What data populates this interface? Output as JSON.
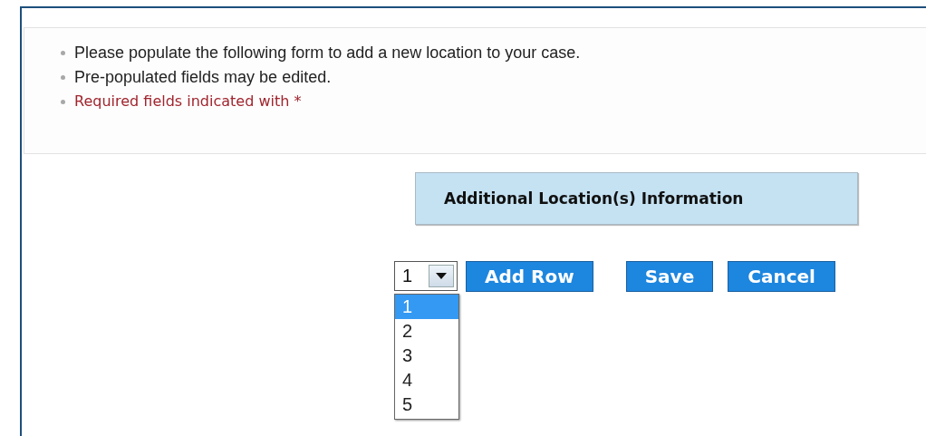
{
  "notes": [
    {
      "text": "Please populate the following form to add a new location to your case.",
      "kind": "normal"
    },
    {
      "text": "Pre-populated fields may be edited.",
      "kind": "normal"
    },
    {
      "text": "Required fields indicated with *",
      "kind": "required"
    }
  ],
  "section_title": "Additional Location(s) Information",
  "row_count_select": {
    "value": "1",
    "expanded": true,
    "options": [
      {
        "label": "1",
        "selected": true
      },
      {
        "label": "2",
        "selected": false
      },
      {
        "label": "3",
        "selected": false
      },
      {
        "label": "4",
        "selected": false
      },
      {
        "label": "5",
        "selected": false
      }
    ]
  },
  "buttons": [
    "Add Row",
    "Save",
    "Cancel"
  ]
}
